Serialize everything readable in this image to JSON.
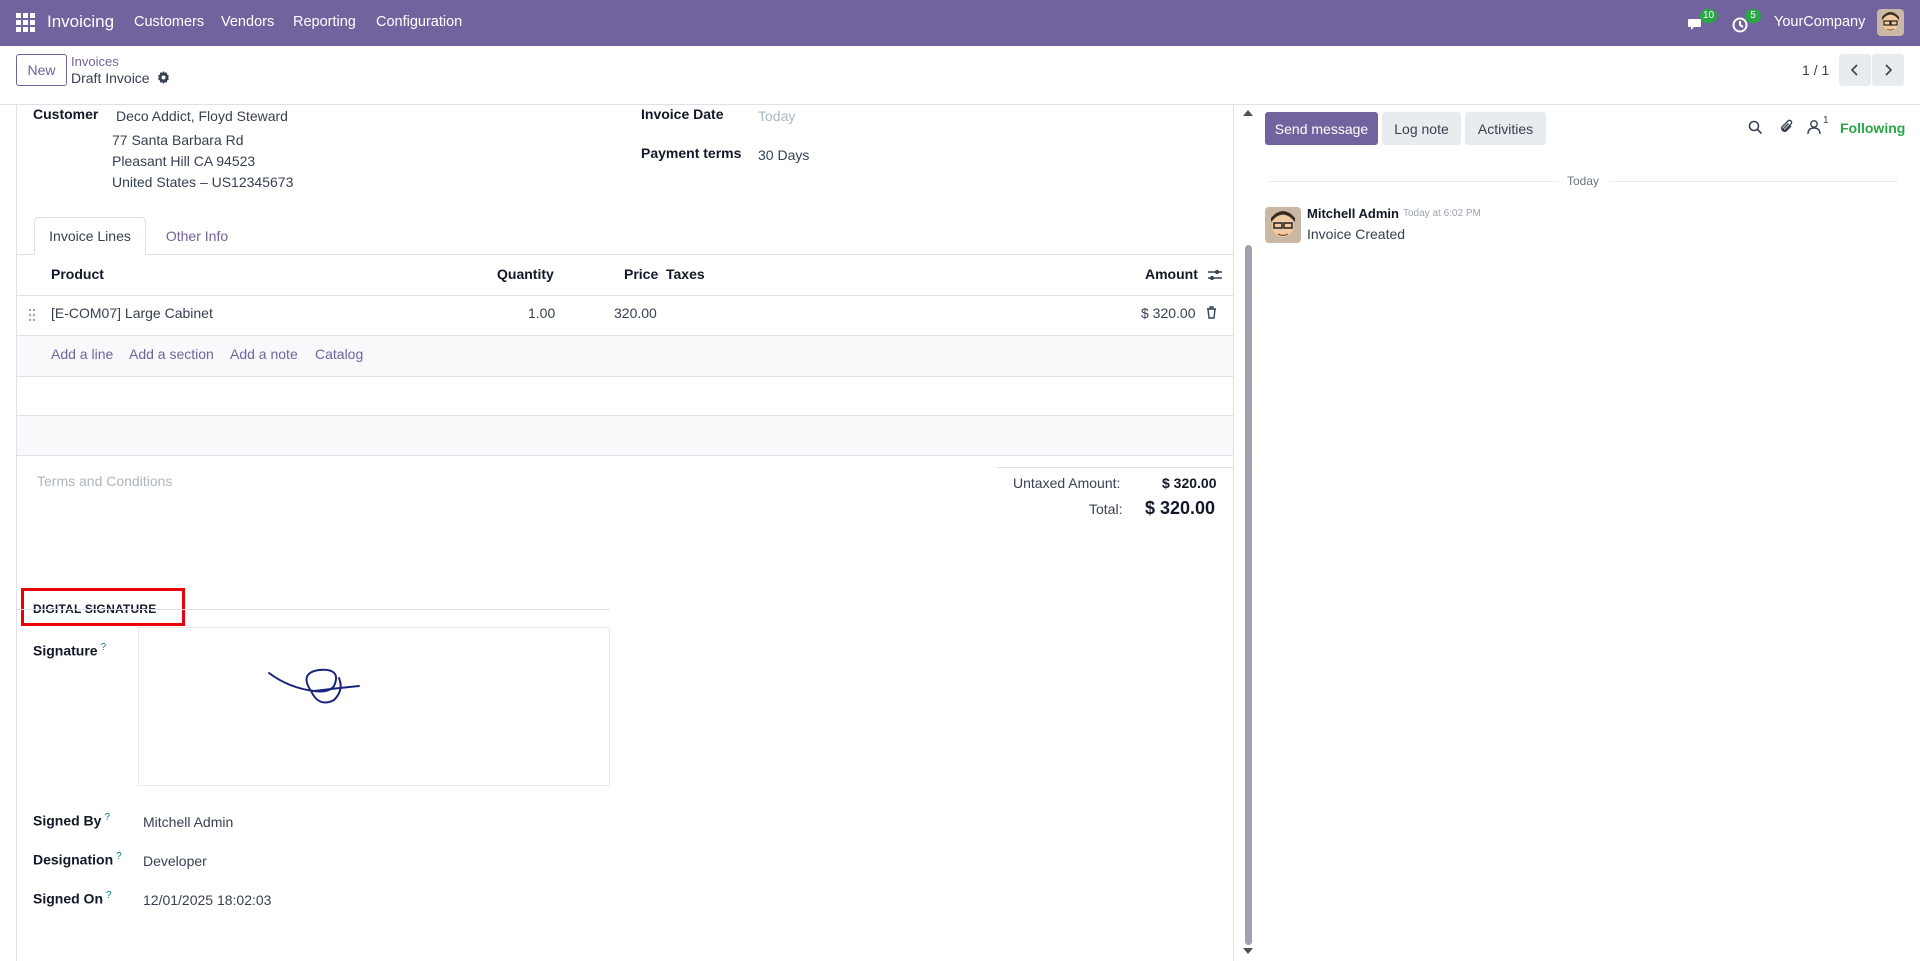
{
  "navbar": {
    "app_name": "Invoicing",
    "menu": [
      "Customers",
      "Vendors",
      "Reporting",
      "Configuration"
    ],
    "messages_count": "10",
    "activities_count": "5",
    "company": "YourCompany",
    "color": "#71639e"
  },
  "control": {
    "new_label": "New",
    "breadcrumb_parent": "Invoices",
    "breadcrumb_current": "Draft Invoice",
    "pager": "1 / 1"
  },
  "form": {
    "customer_label": "Customer",
    "customer_name": "Deco Addict, Floyd Steward",
    "address_line1": "77 Santa Barbara Rd",
    "address_line2": "Pleasant Hill CA 94523",
    "address_line3": "United States – US12345673",
    "invoice_date_label": "Invoice Date",
    "invoice_date_placeholder": "Today",
    "payment_terms_label": "Payment terms",
    "payment_terms_value": "30 Days"
  },
  "tabs": [
    "Invoice Lines",
    "Other Info"
  ],
  "lines_table": {
    "headers": {
      "product": "Product",
      "quantity": "Quantity",
      "price": "Price",
      "taxes": "Taxes",
      "amount": "Amount"
    },
    "rows": [
      {
        "product": "[E-COM07] Large Cabinet",
        "quantity": "1.00",
        "price": "320.00",
        "taxes": "",
        "amount": "$ 320.00"
      }
    ],
    "add_links": [
      "Add a line",
      "Add a section",
      "Add a note",
      "Catalog"
    ]
  },
  "terms_placeholder": "Terms and Conditions",
  "totals": {
    "untaxed_label": "Untaxed Amount:",
    "untaxed_value": "$ 320.00",
    "total_label": "Total:",
    "total_value": "$ 320.00"
  },
  "signature_section": {
    "title": "DIGITAL SIGNATURE",
    "signature_label": "Signature",
    "signed_by_label": "Signed By",
    "signed_by_value": "Mitchell Admin",
    "designation_label": "Designation",
    "designation_value": "Developer",
    "signed_on_label": "Signed On",
    "signed_on_value": "12/01/2025 18:02:03",
    "help_mark": "?"
  },
  "chatter": {
    "send_message": "Send message",
    "log_note": "Log note",
    "activities": "Activities",
    "followers_count": "1",
    "following": "Following",
    "date_separator": "Today",
    "messages": [
      {
        "author": "Mitchell Admin",
        "time": "Today at 6:02 PM",
        "body": "Invoice Created"
      }
    ]
  }
}
